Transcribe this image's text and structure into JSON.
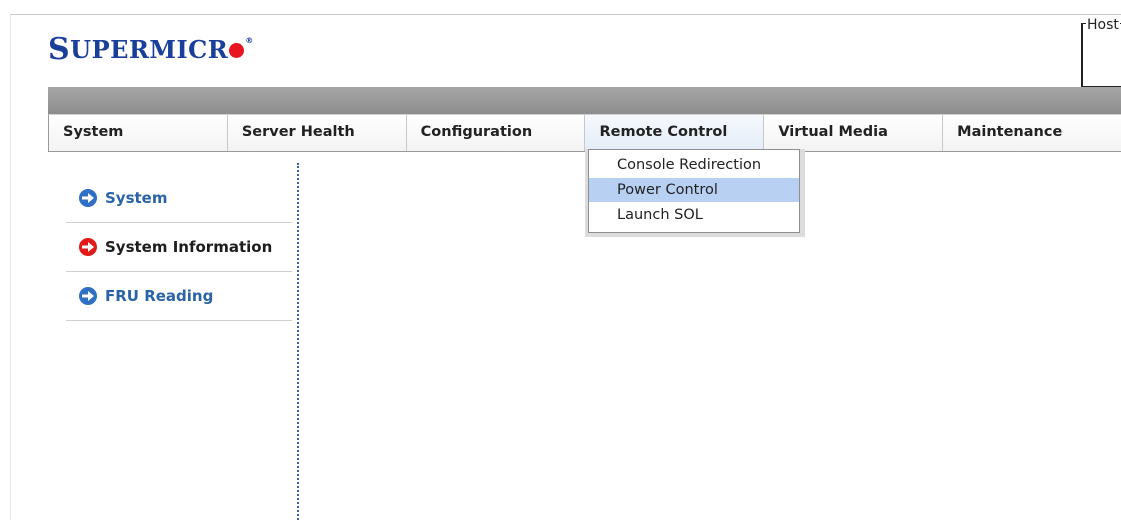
{
  "brand": {
    "logo_initial": "S",
    "logo_rest": "UPERMICR",
    "logo_reg": "®"
  },
  "host": {
    "label": "Host"
  },
  "nav": {
    "tabs": [
      {
        "label": "System"
      },
      {
        "label": "Server Health"
      },
      {
        "label": "Configuration"
      },
      {
        "label": "Remote Control",
        "active": true
      },
      {
        "label": "Virtual Media"
      },
      {
        "label": "Maintenance"
      }
    ]
  },
  "dropdown": {
    "items": [
      {
        "label": "Console Redirection"
      },
      {
        "label": "Power Control",
        "highlighted": true
      },
      {
        "label": "Launch SOL"
      }
    ]
  },
  "sidebar": {
    "items": [
      {
        "label": "System",
        "icon": "arrow-right-circle-blue-icon"
      },
      {
        "label": "System Information",
        "icon": "arrow-right-circle-red-icon",
        "active": true
      },
      {
        "label": "FRU Reading",
        "icon": "arrow-right-circle-blue-icon"
      }
    ]
  },
  "colors": {
    "brand_blue": "#1a3f9b",
    "brand_red": "#e8141f",
    "link_blue": "#2a63a8",
    "menu_highlight": "#b8d1f3"
  }
}
